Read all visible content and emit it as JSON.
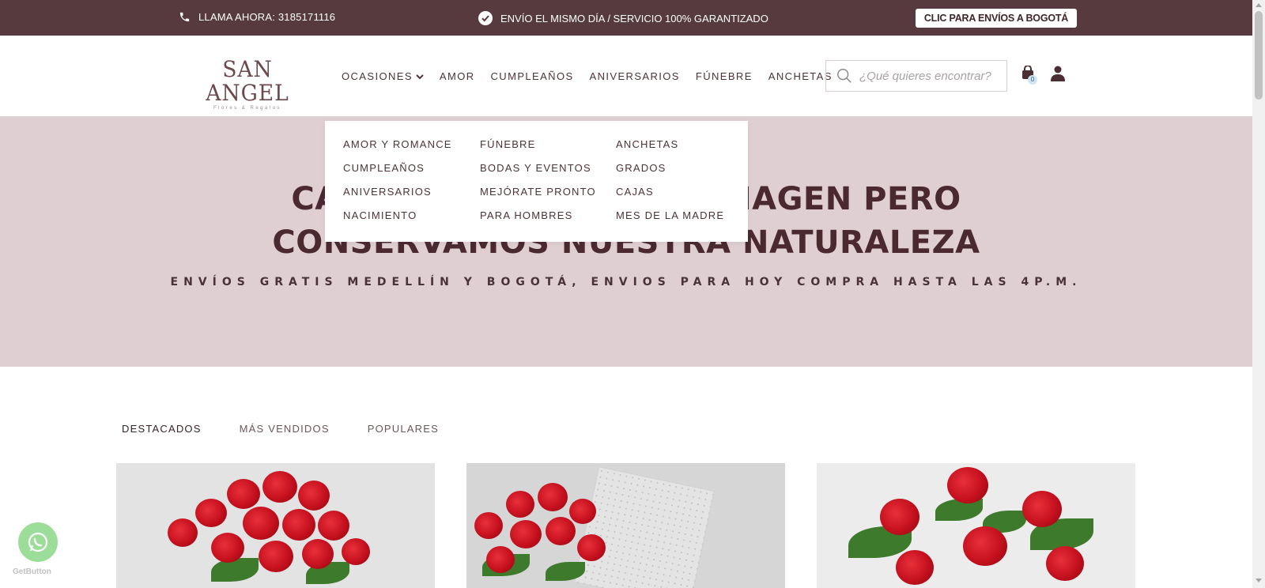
{
  "topbar": {
    "call_text": "LLAMA AHORA: 3185171116",
    "promise_text": "ENVÍO EL MISMO DÍA / SERVICIO 100% GARANTIZADO",
    "bogota_button": "CLIC PARA ENVÍOS A BOGOTÁ",
    "background_color": "#573a3d",
    "phone_icon": "phone-icon",
    "check_icon": "check-circle-icon"
  },
  "header": {
    "logo_main": "SAN ANGEL",
    "logo_sub": "Flores & Regalos",
    "nav": [
      {
        "label": "OCASIONES"
      },
      {
        "label": "AMOR"
      },
      {
        "label": "CUMPLEAÑOS"
      },
      {
        "label": "ANIVERSARIOS"
      },
      {
        "label": "FÚNEBRE"
      },
      {
        "label": "ANCHETAS"
      }
    ],
    "search_placeholder": "¿Qué quieres encontrar?",
    "cart_count": "0"
  },
  "dropdown": {
    "col1": [
      "AMOR Y ROMANCE",
      "CUMPLEAÑOS",
      "ANIVERSARIOS",
      "NACIMIENTO"
    ],
    "col2": [
      "FÚNEBRE",
      "BODAS Y EVENTOS",
      "MEJÓRATE PRONTO",
      "PARA HOMBRES"
    ],
    "col3": [
      "ANCHETAS",
      "GRADOS",
      "CAJAS",
      "MES DE LA MADRE"
    ]
  },
  "hero": {
    "title_line1": "CAMBIAMOS NUESTRA IMAGEN PERO",
    "title_line2": "CONSERVAMOS NUESTRA NATURALEZA",
    "subtitle": "ENVÍOS GRATIS MEDELLÍN Y BOGOTÁ, ENVIOS PARA HOY COMPRA HASTA LAS 4P.M.",
    "background_color": "#dfcfd3"
  },
  "tabs": [
    {
      "label": "DESTACADOS"
    },
    {
      "label": "MÁS VENDIDOS"
    },
    {
      "label": "POPULARES"
    }
  ],
  "widgets": {
    "getbutton_label": "GetButton"
  }
}
